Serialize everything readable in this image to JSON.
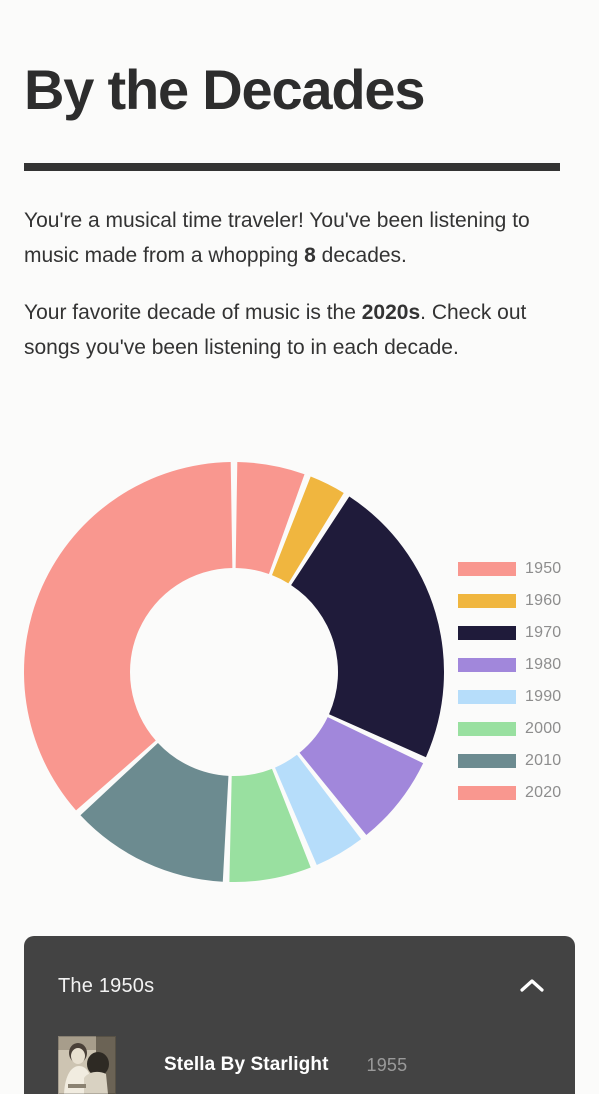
{
  "header": {
    "title": "By the Decades"
  },
  "intro": {
    "paragraph1_part1": "You're a musical time traveler! You've been listening to music made from a whopping ",
    "paragraph1_bold": "8",
    "paragraph1_part2": " decades.",
    "paragraph2_part1": "Your favorite decade of music is the ",
    "paragraph2_bold": "2020s",
    "paragraph2_part2": ". Check out songs you've been listening to in each decade."
  },
  "chart_data": {
    "type": "pie",
    "title": "By the Decades",
    "subtype": "donut",
    "start_angle_deg": 0,
    "direction": "clockwise",
    "inner_radius_ratio": 0.5,
    "legend_position": "right",
    "grid": false,
    "units": "percent of listening",
    "categories": [
      "1950",
      "1960",
      "1970",
      "1980",
      "1990",
      "2000",
      "2010",
      "2020"
    ],
    "values": [
      5.7,
      3.3,
      22.9,
      7.5,
      4.4,
      6.8,
      12.7,
      36.7
    ],
    "angles_deg": [
      20.6,
      11.9,
      82.5,
      27.0,
      15.7,
      24.3,
      45.8,
      132.2
    ],
    "colors": [
      "#F9978F",
      "#F0B63F",
      "#1F1B3A",
      "#A187DB",
      "#B6DDFA",
      "#99E0A0",
      "#6C8B90",
      "#F9978F"
    ],
    "slices": [
      {
        "label": "1950",
        "value": 5.7,
        "color": "#F9978F"
      },
      {
        "label": "1960",
        "value": 3.3,
        "color": "#F0B63F"
      },
      {
        "label": "1970",
        "value": 22.9,
        "color": "#1F1B3A"
      },
      {
        "label": "1980",
        "value": 7.5,
        "color": "#A187DB"
      },
      {
        "label": "1990",
        "value": 4.4,
        "color": "#B6DDFA"
      },
      {
        "label": "2000",
        "value": 6.8,
        "color": "#99E0A0"
      },
      {
        "label": "2010",
        "value": 12.7,
        "color": "#6C8B90"
      },
      {
        "label": "2020",
        "value": 36.7,
        "color": "#F9978F"
      }
    ]
  },
  "legend": [
    {
      "label": "1950",
      "color": "#F9978F"
    },
    {
      "label": "1960",
      "color": "#F0B63F"
    },
    {
      "label": "1970",
      "color": "#1F1B3A"
    },
    {
      "label": "1980",
      "color": "#A187DB"
    },
    {
      "label": "1990",
      "color": "#B6DDFA"
    },
    {
      "label": "2000",
      "color": "#99E0A0"
    },
    {
      "label": "2010",
      "color": "#6C8B90"
    },
    {
      "label": "2020",
      "color": "#F9978F"
    }
  ],
  "decade_card": {
    "title": "The 1950s",
    "toggle_icon": "chevron-up-icon",
    "expanded": true,
    "tracks": [
      {
        "title": "Stella By Starlight",
        "year": "1955",
        "artwork": "album-artwork-sepia-photo"
      }
    ]
  },
  "theme": {
    "page_background": "#fbfbfa",
    "text_color": "#333333",
    "rule_color": "#333333",
    "card_background": "#434343",
    "legend_label_color": "#8d8d8d"
  }
}
